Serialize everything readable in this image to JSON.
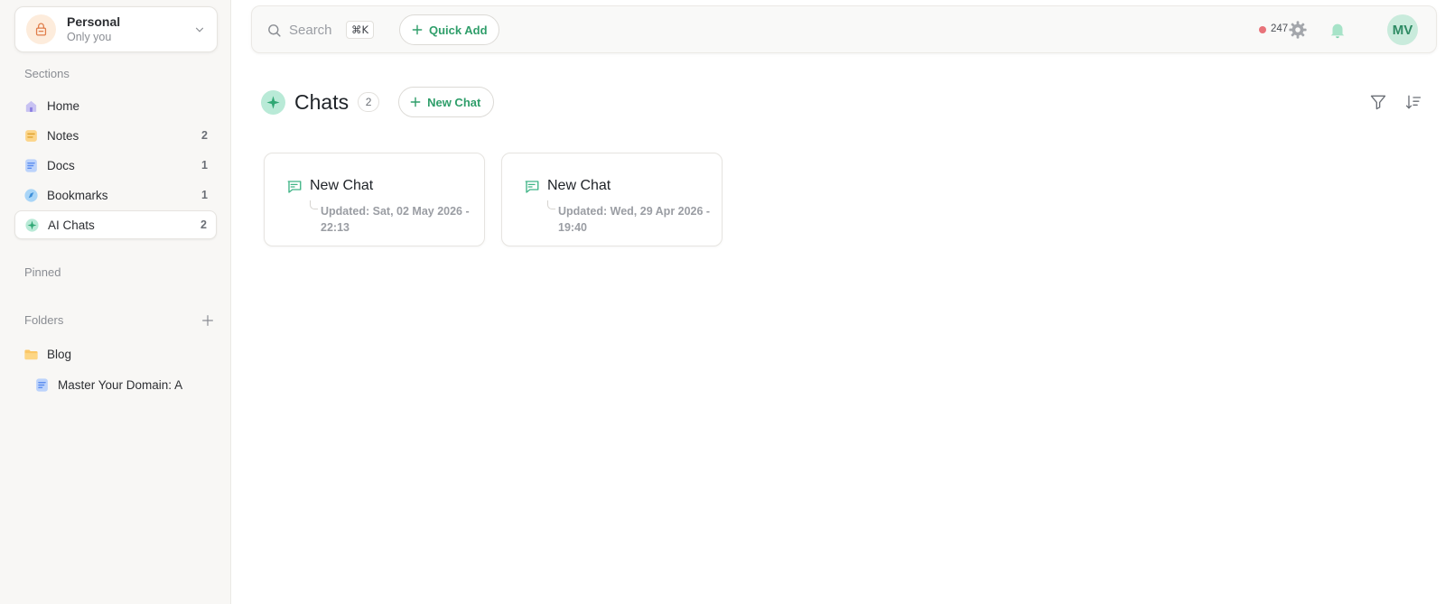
{
  "workspace": {
    "title": "Personal",
    "subtitle": "Only you"
  },
  "sidebar": {
    "sections_label": "Sections",
    "items": [
      {
        "label": "Home",
        "count": "",
        "icon": "home-icon"
      },
      {
        "label": "Notes",
        "count": "2",
        "icon": "notes-icon"
      },
      {
        "label": "Docs",
        "count": "1",
        "icon": "docs-icon"
      },
      {
        "label": "Bookmarks",
        "count": "1",
        "icon": "bookmark-icon"
      },
      {
        "label": "AI Chats",
        "count": "2",
        "icon": "sparkle-icon",
        "active": true
      }
    ],
    "pinned_label": "Pinned",
    "folders_label": "Folders",
    "folders": [
      {
        "label": "Blog",
        "icon": "folder-icon"
      }
    ],
    "folder_docs": [
      {
        "label": "Master Your Domain: A Comprehensive Guide",
        "icon": "doc-icon"
      }
    ]
  },
  "topbar": {
    "search_placeholder": "Search",
    "search_shortcut": "⌘K",
    "quick_add_label": "Quick Add",
    "status_count": "247",
    "avatar_initials": "MV"
  },
  "page": {
    "title": "Chats",
    "count": "2",
    "new_chat_label": "New Chat"
  },
  "chats": [
    {
      "title": "New Chat",
      "updated": "Updated: Sat, 02 May 2026 - 22:13"
    },
    {
      "title": "New Chat",
      "updated": "Updated: Wed, 29 Apr 2026 - 19:40"
    }
  ],
  "colors": {
    "accent": "#2f9e6a",
    "sidebar_bg": "#f8f7f5",
    "status_dot": "#e8737a"
  }
}
